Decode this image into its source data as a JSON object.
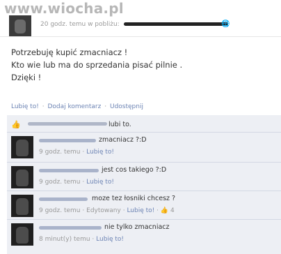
{
  "watermark": "www.wiocha.pl",
  "header": {
    "meta": "20 godz. temu w pobliżu:",
    "globe_icon": "globe-icon"
  },
  "post": {
    "lines": [
      "Potrzebuję kupić zmacniacz !",
      "Kto wie lub ma do sprzedania pisać pilnie .",
      "Dzięki !"
    ]
  },
  "actions": {
    "like": "Lubię to!",
    "comment": "Dodaj komentarz",
    "share": "Udostępnij",
    "sep": "·"
  },
  "likes": {
    "text": "lubi to."
  },
  "comments": [
    {
      "text": "zmacniacz ?:D",
      "time": "9 godz. temu",
      "like": "Lubię to!"
    },
    {
      "text": "jest cos takiego ?:D",
      "time": "9 godz. temu",
      "like": "Lubię to!"
    },
    {
      "text": "moze tez łosniki chcesz ?",
      "time": "9 godz. temu",
      "edited": "Edytowany",
      "like": "Lubię to!",
      "likes_count": "4"
    },
    {
      "text": "nie tylko zmacniacz",
      "time": "8 minut(y) temu",
      "like": "Lubię to!"
    }
  ]
}
